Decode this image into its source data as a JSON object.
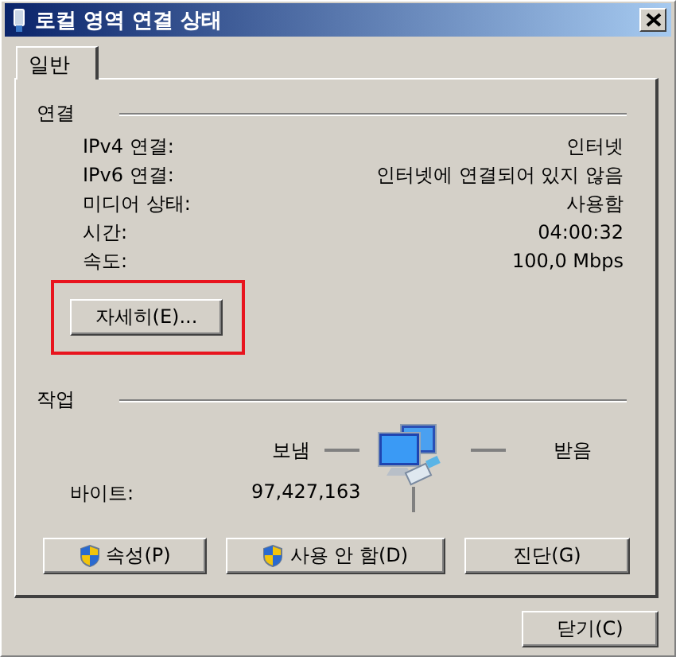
{
  "window": {
    "title": "로컬 영역 연결 상태"
  },
  "tabs": [
    {
      "label": "일반",
      "selected": true
    }
  ],
  "connection": {
    "heading": "연결",
    "rows": [
      {
        "label": "IPv4 연결:",
        "value": "인터넷"
      },
      {
        "label": "IPv6 연결:",
        "value": "인터넷에 연결되어 있지 않음"
      },
      {
        "label": "미디어 상태:",
        "value": "사용함"
      },
      {
        "label": "시간:",
        "value": "04:00:32"
      },
      {
        "label": "속도:",
        "value": "100,0 Mbps"
      }
    ],
    "details_button": "자세히(E)..."
  },
  "activity": {
    "heading": "작업",
    "sent_label": "보냄",
    "received_label": "받음",
    "bytes_label": "바이트:",
    "bytes_sent": "97,427,163"
  },
  "buttons": [
    {
      "label": "속성(P)",
      "shield": true
    },
    {
      "label": "사용 안 함(D)",
      "shield": true
    },
    {
      "label": "진단(G)",
      "shield": false
    }
  ],
  "close_button": "닫기(C)"
}
